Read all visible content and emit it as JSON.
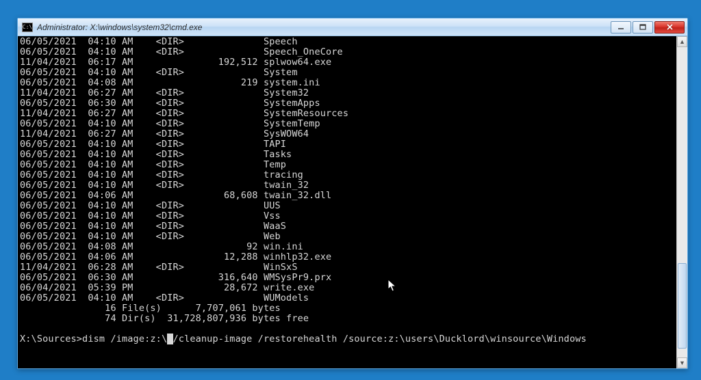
{
  "window": {
    "title": "Administrator: X:\\windows\\system32\\cmd.exe",
    "icon_label": "C:\\"
  },
  "listing": [
    {
      "date": "06/05/2021",
      "time": "04:10 AM",
      "attr": "<DIR>",
      "size": "",
      "name": "Speech"
    },
    {
      "date": "06/05/2021",
      "time": "04:10 AM",
      "attr": "<DIR>",
      "size": "",
      "name": "Speech_OneCore"
    },
    {
      "date": "11/04/2021",
      "time": "06:17 AM",
      "attr": "",
      "size": "192,512",
      "name": "splwow64.exe"
    },
    {
      "date": "06/05/2021",
      "time": "04:10 AM",
      "attr": "<DIR>",
      "size": "",
      "name": "System"
    },
    {
      "date": "06/05/2021",
      "time": "04:08 AM",
      "attr": "",
      "size": "219",
      "name": "system.ini"
    },
    {
      "date": "11/04/2021",
      "time": "06:27 AM",
      "attr": "<DIR>",
      "size": "",
      "name": "System32"
    },
    {
      "date": "06/05/2021",
      "time": "06:30 AM",
      "attr": "<DIR>",
      "size": "",
      "name": "SystemApps"
    },
    {
      "date": "11/04/2021",
      "time": "06:27 AM",
      "attr": "<DIR>",
      "size": "",
      "name": "SystemResources"
    },
    {
      "date": "06/05/2021",
      "time": "04:10 AM",
      "attr": "<DIR>",
      "size": "",
      "name": "SystemTemp"
    },
    {
      "date": "11/04/2021",
      "time": "06:27 AM",
      "attr": "<DIR>",
      "size": "",
      "name": "SysWOW64"
    },
    {
      "date": "06/05/2021",
      "time": "04:10 AM",
      "attr": "<DIR>",
      "size": "",
      "name": "TAPI"
    },
    {
      "date": "06/05/2021",
      "time": "04:10 AM",
      "attr": "<DIR>",
      "size": "",
      "name": "Tasks"
    },
    {
      "date": "06/05/2021",
      "time": "04:10 AM",
      "attr": "<DIR>",
      "size": "",
      "name": "Temp"
    },
    {
      "date": "06/05/2021",
      "time": "04:10 AM",
      "attr": "<DIR>",
      "size": "",
      "name": "tracing"
    },
    {
      "date": "06/05/2021",
      "time": "04:10 AM",
      "attr": "<DIR>",
      "size": "",
      "name": "twain_32"
    },
    {
      "date": "06/05/2021",
      "time": "04:06 AM",
      "attr": "",
      "size": "68,608",
      "name": "twain_32.dll"
    },
    {
      "date": "06/05/2021",
      "time": "04:10 AM",
      "attr": "<DIR>",
      "size": "",
      "name": "UUS"
    },
    {
      "date": "06/05/2021",
      "time": "04:10 AM",
      "attr": "<DIR>",
      "size": "",
      "name": "Vss"
    },
    {
      "date": "06/05/2021",
      "time": "04:10 AM",
      "attr": "<DIR>",
      "size": "",
      "name": "WaaS"
    },
    {
      "date": "06/05/2021",
      "time": "04:10 AM",
      "attr": "<DIR>",
      "size": "",
      "name": "Web"
    },
    {
      "date": "06/05/2021",
      "time": "04:08 AM",
      "attr": "",
      "size": "92",
      "name": "win.ini"
    },
    {
      "date": "06/05/2021",
      "time": "04:06 AM",
      "attr": "",
      "size": "12,288",
      "name": "winhlp32.exe"
    },
    {
      "date": "11/04/2021",
      "time": "06:28 AM",
      "attr": "<DIR>",
      "size": "",
      "name": "WinSxS"
    },
    {
      "date": "06/05/2021",
      "time": "06:30 AM",
      "attr": "",
      "size": "316,640",
      "name": "WMSysPr9.prx"
    },
    {
      "date": "06/04/2021",
      "time": "05:39 PM",
      "attr": "",
      "size": "28,672",
      "name": "write.exe"
    },
    {
      "date": "06/05/2021",
      "time": "04:10 AM",
      "attr": "<DIR>",
      "size": "",
      "name": "WUModels"
    }
  ],
  "summary": {
    "file_count": "16 File(s)",
    "file_bytes": "7,707,061 bytes",
    "dir_count": "74 Dir(s)",
    "dir_bytes": "31,728,807,936 bytes free"
  },
  "prompt": {
    "path": "X:\\Sources>",
    "before_cursor": "dism /image:z:\\",
    "cursor": " ",
    "after_cursor": "/cleanup-image /restorehealth /source:z:\\users\\Ducklord\\winsource\\Windows"
  }
}
